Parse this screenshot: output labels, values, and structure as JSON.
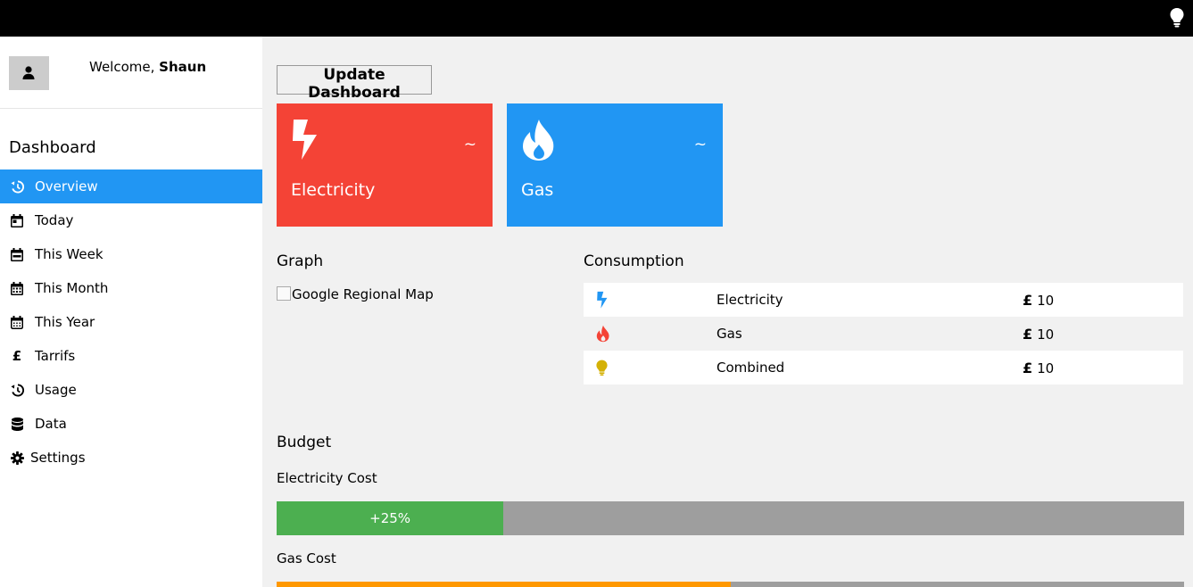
{
  "header": {
    "icon": "lightbulb-icon"
  },
  "user": {
    "welcome_prefix": "Welcome, ",
    "name": "Shaun"
  },
  "sidebar": {
    "title": "Dashboard",
    "items": [
      {
        "label": "Overview",
        "icon": "history-icon",
        "active": true
      },
      {
        "label": "Today",
        "icon": "calendar-day-icon"
      },
      {
        "label": "This Week",
        "icon": "calendar-week-icon"
      },
      {
        "label": "This Month",
        "icon": "calendar-month-icon"
      },
      {
        "label": "This Year",
        "icon": "calendar-year-icon"
      },
      {
        "label": "Tarrifs",
        "icon": "pound-icon",
        "glyph": "£"
      },
      {
        "label": "Usage",
        "icon": "history-icon"
      },
      {
        "label": "Data",
        "icon": "database-icon"
      },
      {
        "label": "Settings",
        "icon": "gear-icon"
      }
    ]
  },
  "main": {
    "update_button": "Update Dashboard",
    "cards": [
      {
        "label": "Electricity",
        "value": "~",
        "color": "#f44336",
        "icon": "bolt-icon"
      },
      {
        "label": "Gas",
        "value": "~",
        "color": "#2196f3",
        "icon": "fire-icon"
      }
    ],
    "graph": {
      "title": "Graph",
      "image_alt": "Google Regional Map"
    },
    "consumption": {
      "title": "Consumption",
      "currency": "£",
      "rows": [
        {
          "name": "Electricity",
          "value": "10",
          "icon": "bolt-icon",
          "icon_color": "#2196f3"
        },
        {
          "name": "Gas",
          "value": "10",
          "icon": "fire-icon",
          "icon_color": "#f44336"
        },
        {
          "name": "Combined",
          "value": "10",
          "icon": "lightbulb-icon",
          "icon_color": "#d4b106"
        }
      ]
    },
    "budget": {
      "title": "Budget",
      "electricity": {
        "label": "Electricity Cost",
        "percent_text": "+25%",
        "fill_fraction": 0.25,
        "color": "#4caf50"
      },
      "gas": {
        "label": "Gas Cost",
        "fill_fraction": 0.5,
        "color": "#ff9800"
      }
    }
  }
}
